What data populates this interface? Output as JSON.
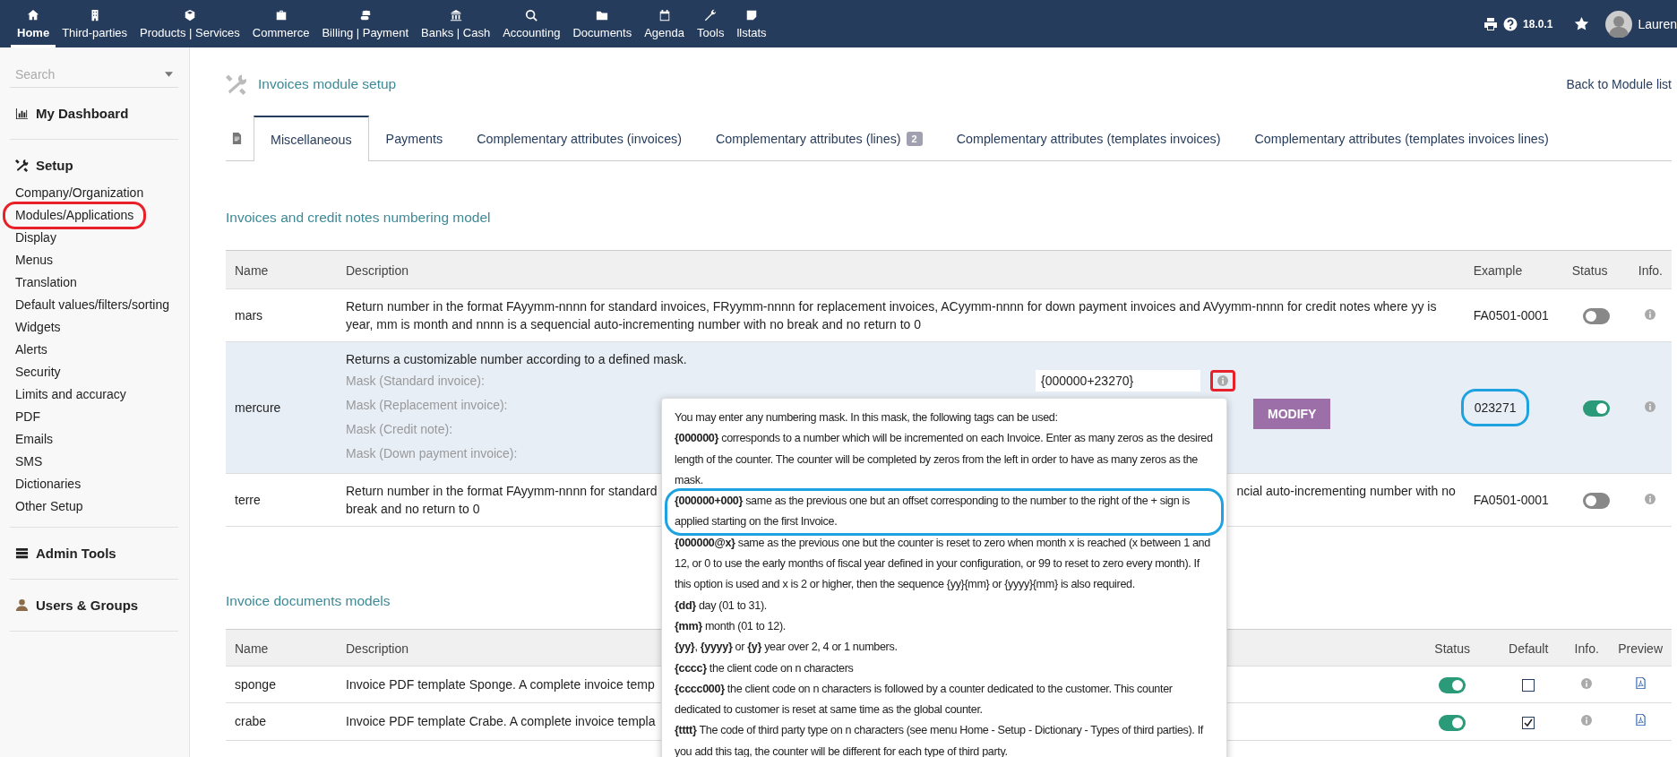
{
  "topnav": {
    "items": [
      {
        "label": "Home",
        "selected": true
      },
      {
        "label": "Third-parties",
        "selected": false
      },
      {
        "label": "Products | Services",
        "selected": false
      },
      {
        "label": "Commerce",
        "selected": false
      },
      {
        "label": "Billing | Payment",
        "selected": false
      },
      {
        "label": "Banks | Cash",
        "selected": false
      },
      {
        "label": "Accounting",
        "selected": false
      },
      {
        "label": "Documents",
        "selected": false
      },
      {
        "label": "Agenda",
        "selected": false
      },
      {
        "label": "Tools",
        "selected": false
      },
      {
        "label": "llstats",
        "selected": false
      }
    ],
    "version": "18.0.1",
    "user": "Lauren"
  },
  "sidebar": {
    "search": {
      "placeholder": "Search"
    },
    "sections": [
      {
        "title": "My Dashboard"
      },
      {
        "title": "Setup",
        "items": [
          {
            "label": "Company/Organization",
            "circled": false
          },
          {
            "label": "Modules/Applications",
            "circled": true
          },
          {
            "label": "Display",
            "circled": false
          },
          {
            "label": "Menus",
            "circled": false
          },
          {
            "label": "Translation",
            "circled": false
          },
          {
            "label": "Default values/filters/sorting",
            "circled": false
          },
          {
            "label": "Widgets",
            "circled": false
          },
          {
            "label": "Alerts",
            "circled": false
          },
          {
            "label": "Security",
            "circled": false
          },
          {
            "label": "Limits and accuracy",
            "circled": false
          },
          {
            "label": "PDF",
            "circled": false
          },
          {
            "label": "Emails",
            "circled": false
          },
          {
            "label": "SMS",
            "circled": false
          },
          {
            "label": "Dictionaries",
            "circled": false
          },
          {
            "label": "Other Setup",
            "circled": false
          }
        ]
      },
      {
        "title": "Admin Tools"
      },
      {
        "title": "Users & Groups"
      }
    ]
  },
  "page": {
    "title": "Invoices module setup",
    "back_link": "Back to Module list"
  },
  "tabs": [
    {
      "kind": "icon",
      "selected": false
    },
    {
      "label": "Miscellaneous",
      "kind": "text",
      "selected": true
    },
    {
      "label": "Payments",
      "kind": "text",
      "selected": false
    },
    {
      "label": "Complementary attributes (invoices)",
      "kind": "text",
      "selected": false
    },
    {
      "label": "Complementary attributes (lines)",
      "kind": "text",
      "badge": "2",
      "selected": false
    },
    {
      "label": "Complementary attributes (templates invoices)",
      "kind": "text",
      "selected": false
    },
    {
      "label": "Complementary attributes (templates invoices lines)",
      "kind": "text",
      "selected": false
    }
  ],
  "numbering": {
    "heading": "Invoices and credit notes numbering model",
    "columns": [
      "Name",
      "Description",
      "Example",
      "Status",
      "Info."
    ],
    "rows": [
      {
        "name": "mars",
        "kind": "plain",
        "description": "Return number in the format FAyymm-nnnn for standard invoices, FRyymm-nnnn for replacement invoices, ACyymm-nnnn for down payment invoices and AVyymm-nnnn for credit notes where yy is year, mm is month and nnnn is a sequencial auto-incrementing number with no break and no return to 0",
        "example": "FA0501-0001",
        "example_circled": false,
        "on": false
      },
      {
        "name": "mercure",
        "kind": "mask",
        "description": "Returns a customizable number according to a defined mask.",
        "masks": [
          {
            "label": "Mask (Standard invoice):",
            "value": "{000000+23270}",
            "info_circled": true
          },
          {
            "label": "Mask (Replacement invoice):"
          },
          {
            "label": "Mask (Credit note):"
          },
          {
            "label": "Mask (Down payment invoice):"
          }
        ],
        "button": "MODIFY",
        "example": "023271",
        "example_circled": true,
        "on": true
      },
      {
        "name": "terre",
        "kind": "split",
        "description_start": "Return number in the format FAyymm-nnnn for standard",
        "description_end": "ncial auto-incrementing number with no",
        "description_line2": "break and no return to 0",
        "example": "FA0501-0001",
        "example_circled": false,
        "on": false
      }
    ]
  },
  "documents": {
    "heading": "Invoice documents models",
    "columns": [
      "Name",
      "Description",
      "Status",
      "Default",
      "Info.",
      "Preview"
    ],
    "rows": [
      {
        "name": "sponge",
        "description": "Invoice PDF template Sponge. A complete invoice temp",
        "on": true,
        "checked": false
      },
      {
        "name": "crabe",
        "description": "Invoice PDF template Crabe. A complete invoice templa",
        "on": true,
        "checked": true
      }
    ]
  },
  "tooltip": {
    "paragraphs": [
      {
        "text": "You may enter any numbering mask. In this mask, the following tags can be used:",
        "circled": false
      },
      {
        "text": "**{000000}** corresponds to a number which will be incremented on each Invoice. Enter as many zeros as the desired length of the counter. The counter will be completed by zeros from the left in order to have as many zeros as the mask.",
        "circled": false
      },
      {
        "text": "**{000000+000}** same as the previous one but an offset corresponding to the number to the right of the + sign is applied starting on the first Invoice.",
        "circled": true
      },
      {
        "text": "**{000000@x}** same as the previous one but the counter is reset to zero when month x is reached (x between 1 and 12, or 0 to use the early months of fiscal year defined in your configuration, or 99 to reset to zero every month). If this option is used and x is 2 or higher, then the sequence {yy}{mm} or {yyyy}{mm} is also required.",
        "circled": false
      },
      {
        "text": "**{dd}** day (01 to 31).",
        "circled": false
      },
      {
        "text": "**{mm}** month (01 to 12).",
        "circled": false
      },
      {
        "text": "**{yy}**, **{yyyy}** or **{y}** year over 2, 4 or 1 numbers.",
        "circled": false
      },
      {
        "text": "**{cccc}** the client code on n characters",
        "circled": false
      },
      {
        "text": "**{cccc000}** the client code on n characters is followed by a counter dedicated to the customer. This counter dedicated to customer is reset at same time as the global counter.",
        "circled": false
      },
      {
        "text": "**{tttt}** The code of third party type on n characters (see menu Home - Setup - Dictionary - Types of third parties). If you add this tag, the counter will be different for each type of third party.",
        "circled": false
      }
    ]
  }
}
